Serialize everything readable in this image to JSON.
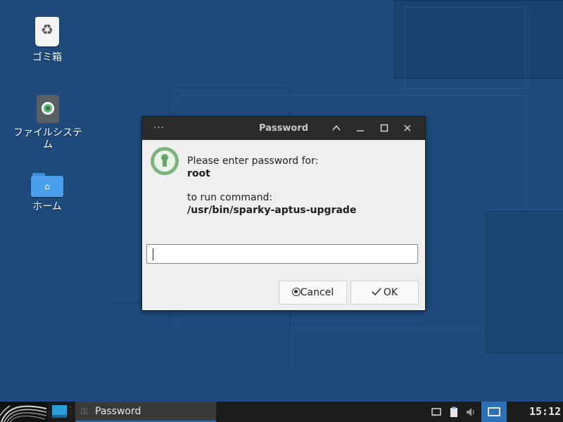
{
  "desktop": {
    "icons": [
      {
        "label": "ゴミ箱",
        "icon": "trash-icon"
      },
      {
        "label": "ファイルシステム",
        "icon": "filesystem-icon"
      },
      {
        "label": "ホーム",
        "icon": "home-folder-icon"
      }
    ]
  },
  "dialog": {
    "title": "Password",
    "menu_glyph": "···",
    "prompt_line1": "Please enter password for:",
    "user": "root",
    "prompt_line2": "to run command:",
    "command": "/usr/bin/sparky-aptus-upgrade",
    "password_value": "",
    "buttons": {
      "cancel_label": "Cancel",
      "ok_label": "OK"
    }
  },
  "taskbar": {
    "tasks": [
      {
        "label": "Password"
      }
    ],
    "clock": "15:12",
    "accent_color": "#2d6fb3"
  }
}
